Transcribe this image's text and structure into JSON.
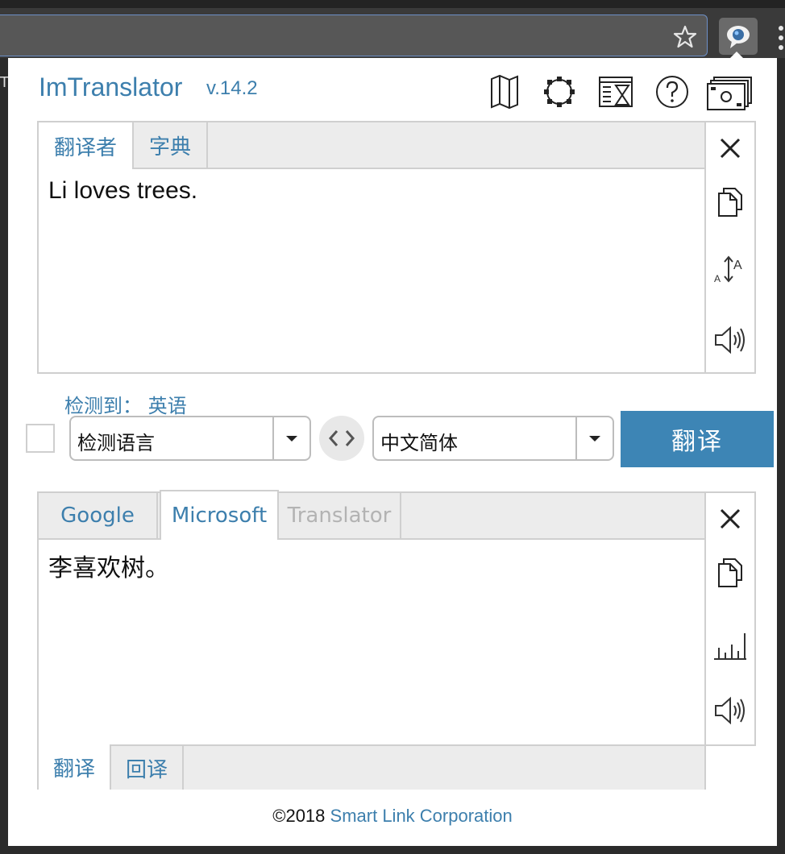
{
  "app": {
    "title": "ImTranslator",
    "version": "v.14.2"
  },
  "toolbar_icons": [
    "map-icon",
    "settings-icon",
    "history-icon",
    "help-icon",
    "options-icon"
  ],
  "source_panel": {
    "tabs": [
      {
        "label": "翻译者",
        "active": true
      },
      {
        "label": "字典",
        "active": false
      }
    ],
    "text": "Li loves trees.",
    "tools": [
      "close-icon",
      "copy-icon",
      "font-size-icon",
      "speaker-icon"
    ]
  },
  "language_bar": {
    "detected_label": "检测到：",
    "detected_language": "英语",
    "source_language": "检测语言",
    "target_language": "中文简体",
    "translate_button": "翻译"
  },
  "result_panel": {
    "tabs": [
      {
        "label": "Google",
        "active": false,
        "disabled": false
      },
      {
        "label": "Microsoft",
        "active": true,
        "disabled": false
      },
      {
        "label": "Translator",
        "active": false,
        "disabled": true
      }
    ],
    "text": "李喜欢树。",
    "bottom_tabs": [
      {
        "label": "翻译",
        "active": true
      },
      {
        "label": "回译",
        "active": false
      }
    ],
    "tools": [
      "close-icon",
      "copy-icon",
      "chart-icon",
      "speaker-icon"
    ]
  },
  "footer": {
    "copyright": "©2018",
    "company": "Smart Link Corporation"
  },
  "colors": {
    "accent": "#3d7fad",
    "button": "#3d85b5",
    "border": "#cfcfcf",
    "tab_bg": "#ececec"
  }
}
